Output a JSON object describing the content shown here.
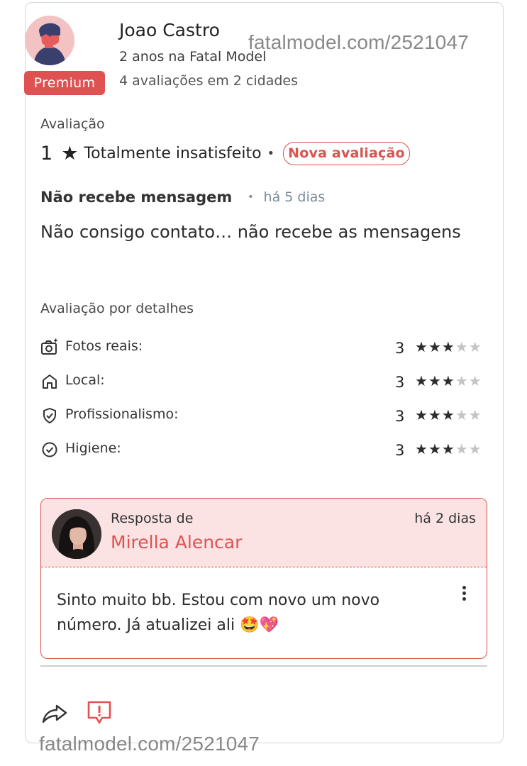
{
  "reviewer": {
    "name": "Joao Castro",
    "since": "2 anos na Fatal Model",
    "stats": "4 avaliações em 2 cidades",
    "badge": "Premium"
  },
  "watermark": "fatalmodel.com/2521047",
  "rating": {
    "label": "Avaliação",
    "score": "1",
    "star": "★",
    "text": "Totalmente insatisfeito",
    "dot": "•",
    "new_badge": "Nova avaliação"
  },
  "review": {
    "title": "Não recebe mensagem",
    "separator": "•",
    "ago": "há 5 dias",
    "body": "Não consigo contato… não recebe as mensagens"
  },
  "details": {
    "title": "Avaliação por detalhes",
    "max_stars": 5,
    "items": [
      {
        "icon": "camera-icon",
        "label": "Fotos reais:",
        "score": "3",
        "stars": 3
      },
      {
        "icon": "home-icon",
        "label": "Local:",
        "score": "3",
        "stars": 3
      },
      {
        "icon": "shield-check-icon",
        "label": "Profissionalismo:",
        "score": "3",
        "stars": 3
      },
      {
        "icon": "check-circle-icon",
        "label": "Higiene:",
        "score": "3",
        "stars": 3
      }
    ]
  },
  "reply": {
    "from_label": "Resposta de",
    "author": "Mirella Alencar",
    "ago": "há 2 dias",
    "body": "Sinto muito bb. Estou com novo um novo número. Já atualizei ali 🤩💖"
  },
  "actions": {
    "share_icon": "share-arrow-icon",
    "report_icon": "report-alert-icon"
  },
  "colors": {
    "accent": "#e05252",
    "reply_bg": "#fbe3e4",
    "star_on": "#2d2d2d",
    "star_off": "#c4c4c4"
  }
}
